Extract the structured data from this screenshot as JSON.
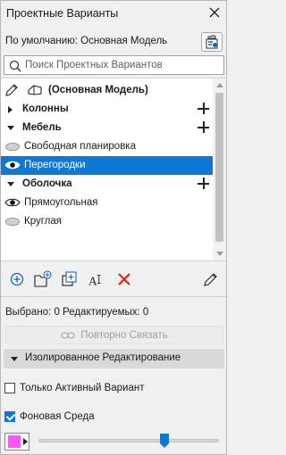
{
  "panel": {
    "title": "Проектные Варианты",
    "close_icon": "close-icon"
  },
  "default_label": "По умолчанию: Основная Модель",
  "search": {
    "placeholder": "Поиск Проектных Вариантов"
  },
  "base_model": {
    "label": "(Основная Модель)"
  },
  "items": [
    {
      "label": "Колонны",
      "kind": "group",
      "expanded": false
    },
    {
      "label": "Мебель",
      "kind": "group",
      "expanded": true
    },
    {
      "label": "Свободная планировка",
      "kind": "option",
      "visible": false
    },
    {
      "label": "Перегородки",
      "kind": "option",
      "visible": true,
      "selected": true
    },
    {
      "label": "Оболочка",
      "kind": "group",
      "expanded": true
    },
    {
      "label": "Прямоугольная",
      "kind": "option",
      "visible": true
    },
    {
      "label": "Круглая",
      "kind": "option",
      "visible": false
    }
  ],
  "toolbar": {
    "icons": [
      "add-option-icon",
      "add-group-icon",
      "duplicate-icon",
      "rename-icon",
      "delete-icon",
      "edit-icon"
    ]
  },
  "status": "Выбрано: 0 Редактируемых: 0",
  "relink_label": "Повторно Связать",
  "isolated_edit": {
    "label": "Изолированное Редактирование"
  },
  "only_active": {
    "label": "Только Активный Вариант",
    "checked": false
  },
  "background": {
    "label": "Фоновая Среда",
    "checked": true
  },
  "colors": {
    "accent": "#0f78d7",
    "swatch": "#ff55ff",
    "delete": "#e2231a"
  },
  "slider": {
    "value": 0.7
  }
}
